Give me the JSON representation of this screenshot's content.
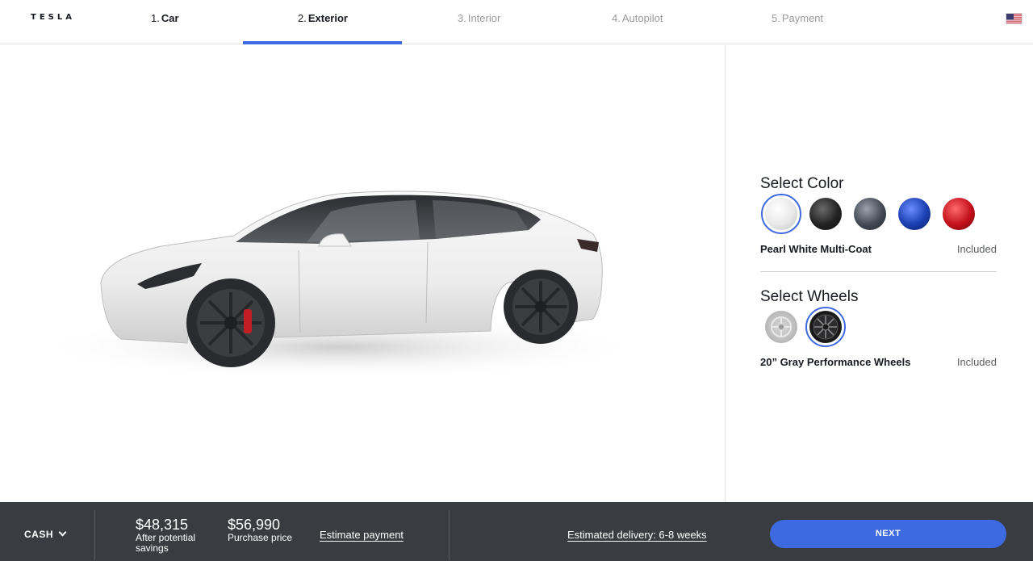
{
  "brand": {
    "logo_text": "TESLA"
  },
  "steps": [
    {
      "num": "1.",
      "label": "Car",
      "state": "done"
    },
    {
      "num": "2.",
      "label": "Exterior",
      "state": "active"
    },
    {
      "num": "3.",
      "label": "Interior",
      "state": "upcoming"
    },
    {
      "num": "4.",
      "label": "Autopilot",
      "state": "upcoming"
    },
    {
      "num": "5.",
      "label": "Payment",
      "state": "upcoming"
    }
  ],
  "header": {
    "flag_icon": "us-flag-icon"
  },
  "color_section": {
    "title": "Select Color",
    "selected_name": "Pearl White Multi-Coat",
    "selected_price": "Included",
    "swatches": [
      {
        "name": "pearl-white",
        "color": "#f1f1f1",
        "selected": true
      },
      {
        "name": "solid-black",
        "color": "#1f1f1f",
        "selected": false
      },
      {
        "name": "midnight-silver",
        "color": "#3f4651",
        "selected": false
      },
      {
        "name": "deep-blue",
        "color": "#1a3fb0",
        "selected": false
      },
      {
        "name": "red-multi-coat",
        "color": "#c3101b",
        "selected": false
      }
    ]
  },
  "wheels_section": {
    "title": "Select Wheels",
    "selected_name": "20” Gray Performance Wheels",
    "selected_price": "Included",
    "options": [
      {
        "name": "aero-wheel",
        "selected": false
      },
      {
        "name": "performance-wheel",
        "selected": true
      }
    ]
  },
  "footer": {
    "payment_mode": "CASH",
    "savings_price": "$48,315",
    "savings_label_1": "After potential",
    "savings_label_2": "savings",
    "purchase_price": "$56,990",
    "purchase_label": "Purchase price",
    "estimate_link": "Estimate payment",
    "delivery_link": "Estimated delivery: 6-8 weeks",
    "next_label": "NEXT"
  },
  "colors": {
    "accent": "#3e6ae1",
    "footer_bg": "#393c41"
  }
}
